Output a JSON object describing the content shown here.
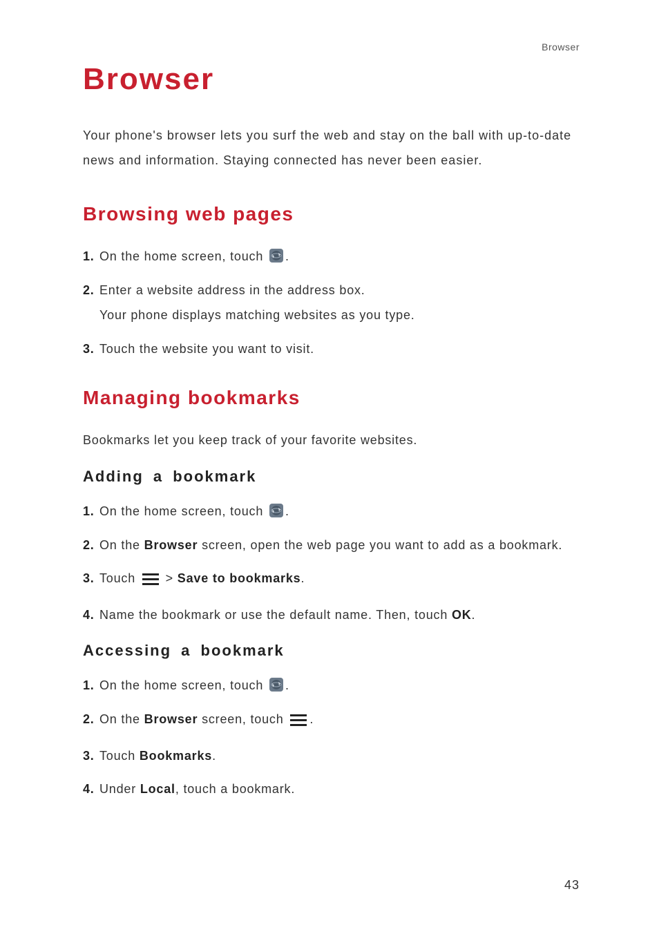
{
  "running_header": "Browser",
  "title": "Browser",
  "intro": "Your phone's browser lets you surf the web and stay on the ball with up-to-date news and information. Staying connected has never been easier.",
  "sections": {
    "browsing": {
      "title": "Browsing web pages",
      "steps": {
        "s1": {
          "num": "1.",
          "text": "On the home screen, touch "
        },
        "s2": {
          "num": "2.",
          "text": "Enter a website address in the address box.",
          "sub": "Your phone displays matching websites as you type."
        },
        "s3": {
          "num": "3.",
          "text": "Touch the website you want to visit."
        }
      }
    },
    "managing": {
      "title": "Managing bookmarks",
      "intro": "Bookmarks let you keep track of your favorite websites.",
      "adding": {
        "title": "Adding a bookmark",
        "steps": {
          "s1": {
            "num": "1.",
            "text": "On the home screen, touch "
          },
          "s2": {
            "num": "2.",
            "pre": "On the ",
            "bold1": "Browser",
            "post": " screen, open the web page you want to add as a bookmark."
          },
          "s3": {
            "num": "3.",
            "pre": "Touch ",
            "gt": " > ",
            "bold1": "Save to bookmarks",
            "post": "."
          },
          "s4": {
            "num": "4.",
            "pre": "Name the bookmark or use the default name. Then, touch ",
            "bold1": "OK",
            "post": "."
          }
        }
      },
      "accessing": {
        "title": "Accessing a bookmark",
        "steps": {
          "s1": {
            "num": "1.",
            "text": "On the home screen, touch "
          },
          "s2": {
            "num": "2.",
            "pre": "On the ",
            "bold1": "Browser",
            "post": " screen, touch "
          },
          "s3": {
            "num": "3.",
            "pre": "Touch ",
            "bold1": "Bookmarks",
            "post": "."
          },
          "s4": {
            "num": "4.",
            "pre": "Under ",
            "bold1": "Local",
            "post": ", touch a bookmark."
          }
        }
      }
    }
  },
  "icons": {
    "browser": "browser-icon",
    "menu": "menu-icon"
  },
  "page_number": "43"
}
